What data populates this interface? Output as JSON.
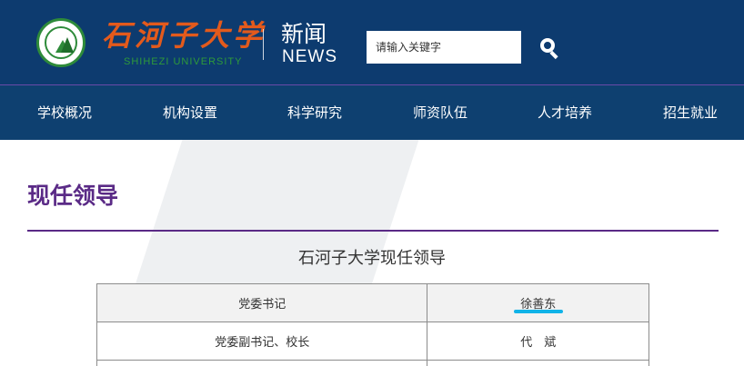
{
  "header": {
    "school_name_cn": "石河子大学",
    "school_name_en": "SHIHEZI UNIVERSITY",
    "section_cn": "新闻",
    "section_en": "NEWS",
    "search": {
      "placeholder": "请输入关键字",
      "value": ""
    },
    "colors": {
      "background": "#0d3b6f",
      "school_name": "#e35a1c",
      "school_en": "#2e9a3a"
    }
  },
  "nav": {
    "items": [
      {
        "label": "学校概况"
      },
      {
        "label": "机构设置"
      },
      {
        "label": "科学研究"
      },
      {
        "label": "师资队伍"
      },
      {
        "label": "人才培养"
      },
      {
        "label": "招生就业"
      }
    ]
  },
  "main": {
    "page_title": "现任领导",
    "table_caption": "石河子大学现任领导",
    "rows": [
      {
        "position": "党委书记",
        "name": "徐善东"
      },
      {
        "position": "党委副书记、校长",
        "name": "代　斌"
      },
      {
        "position": "",
        "name": ""
      }
    ],
    "colors": {
      "accent": "#5a2a86",
      "highlight": "#11b3e8"
    }
  }
}
